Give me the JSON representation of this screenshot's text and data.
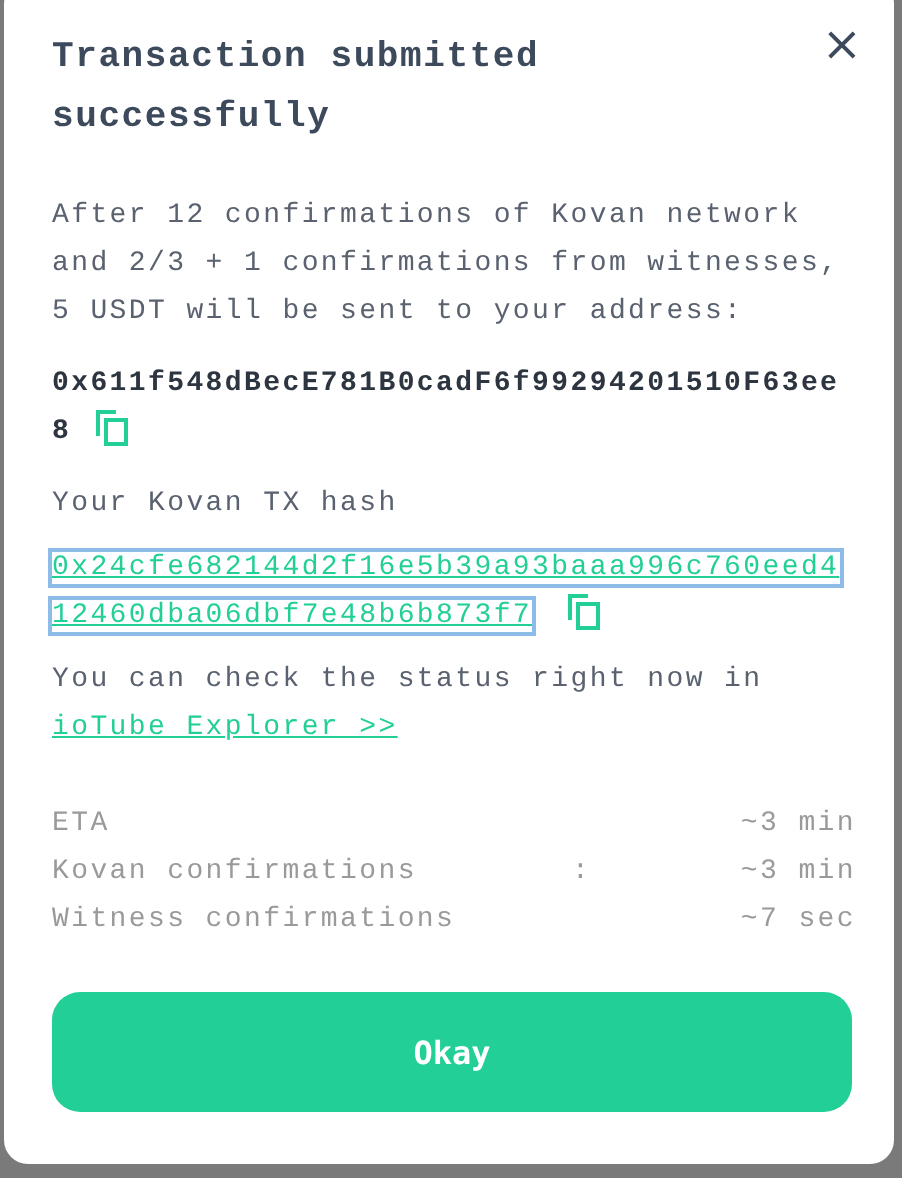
{
  "dialog": {
    "title": "Transaction submitted successfully",
    "close": "×",
    "message": "After 12 confirmations of Kovan network and 2/3 + 1 confirmations from witnesses, 5 USDT will be sent to your address:",
    "address": "0x611f548dBecE781B0cadF6f99294201510F63ee8",
    "hash_label": "Your Kovan TX hash",
    "hash": {
      "lines": [
        "0x24cfe682144d2f16e5b39a93baaa996c760eed4",
        "12460dba06dbf7e48b6b873f7"
      ],
      "focused": true
    },
    "check_text": "You can check the status right now in",
    "explorer_link": "ioTube Explorer >>",
    "details": [
      {
        "label": "ETA",
        "value": "~3 min"
      },
      {
        "label": "Kovan confirmations",
        "separator": ":",
        "value": "~3 min"
      },
      {
        "label": "Witness confirmations",
        "value": "~7 sec"
      }
    ],
    "button": "Okay"
  }
}
